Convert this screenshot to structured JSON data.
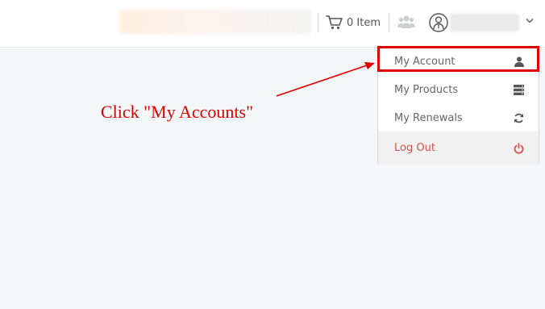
{
  "header": {
    "cart": {
      "icon": "shopping-cart-icon",
      "count_label": "0 Item"
    },
    "group_icon": "users-icon",
    "avatar_icon": "user-avatar-icon",
    "menu_caret_icon": "chevron-down-icon"
  },
  "dropdown": {
    "items": [
      {
        "label": "My Account",
        "icon": "user-icon"
      },
      {
        "label": "My Products",
        "icon": "server-icon"
      },
      {
        "label": "My Renewals",
        "icon": "refresh-icon"
      },
      {
        "label": "Log Out",
        "icon": "power-icon"
      }
    ]
  },
  "annotation": {
    "text": "Click \"My Accounts\""
  },
  "colors": {
    "accent_red": "#e00000",
    "logout_red": "#d9534f",
    "page_bg": "#f4f7f7"
  }
}
